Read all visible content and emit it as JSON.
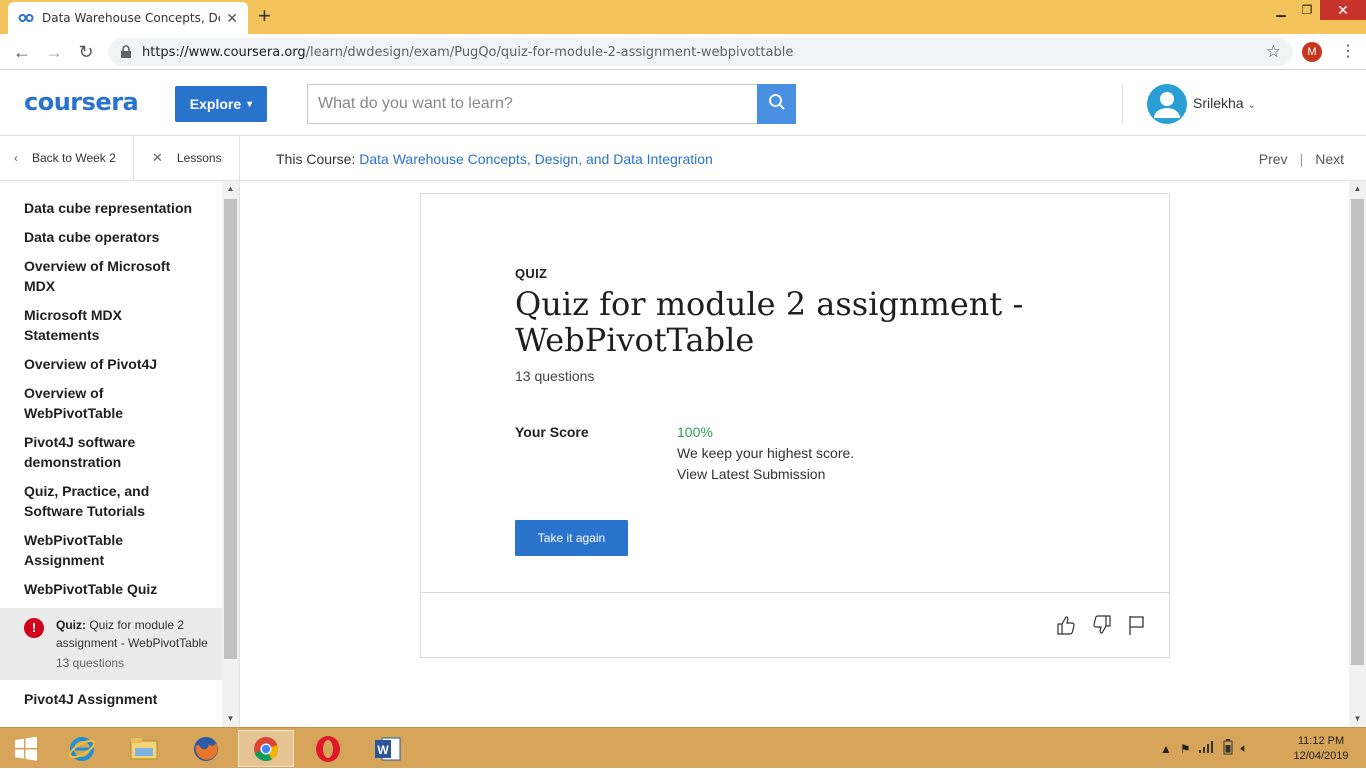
{
  "browser": {
    "tab_title": "Data Warehouse Concepts, Desig",
    "url_host": "https://www.coursera.org",
    "url_path": "/learn/dwdesign/exam/PugQo/quiz-for-module-2-assignment-webpivottable",
    "profile_initial": "M"
  },
  "header": {
    "logo": "coursera",
    "explore_label": "Explore",
    "search_placeholder": "What do you want to learn?",
    "user_name": "Srilekha"
  },
  "subheader": {
    "back_label": "Back to Week 2",
    "lessons_label": "Lessons",
    "course_prefix": "This Course:",
    "course_name": "Data Warehouse Concepts, Design, and Data Integration",
    "prev_label": "Prev",
    "next_label": "Next"
  },
  "sidebar": {
    "items": [
      "Data cube representation",
      "Data cube operators",
      "Overview of Microsoft MDX",
      "Microsoft MDX Statements",
      "Overview of Pivot4J",
      "Overview of WebPivotTable",
      "Pivot4J software demonstration",
      "Quiz, Practice, and Software Tutorials",
      "WebPivotTable Assignment",
      "WebPivotTable Quiz"
    ],
    "active": {
      "type_label": "Quiz:",
      "title": "Quiz for module 2 assignment - WebPivotTable",
      "meta": "13 questions",
      "alert_glyph": "!"
    },
    "next_item": "Pivot4J Assignment"
  },
  "quiz": {
    "tag": "QUIZ",
    "title": "Quiz for module 2 assignment - WebPivotTable",
    "count": "13 questions",
    "score_label": "Your Score",
    "score_value": "100%",
    "score_note": "We keep your highest score.",
    "view_link": "View Latest Submission",
    "retake_label": "Take it again"
  },
  "taskbar": {
    "time": "11:12 PM",
    "date": "12/04/2019"
  },
  "colors": {
    "brand": "#2a73cc",
    "score": "#2b9e56",
    "tabbar": "#f2c45b",
    "taskbar": "#d6a55a"
  }
}
